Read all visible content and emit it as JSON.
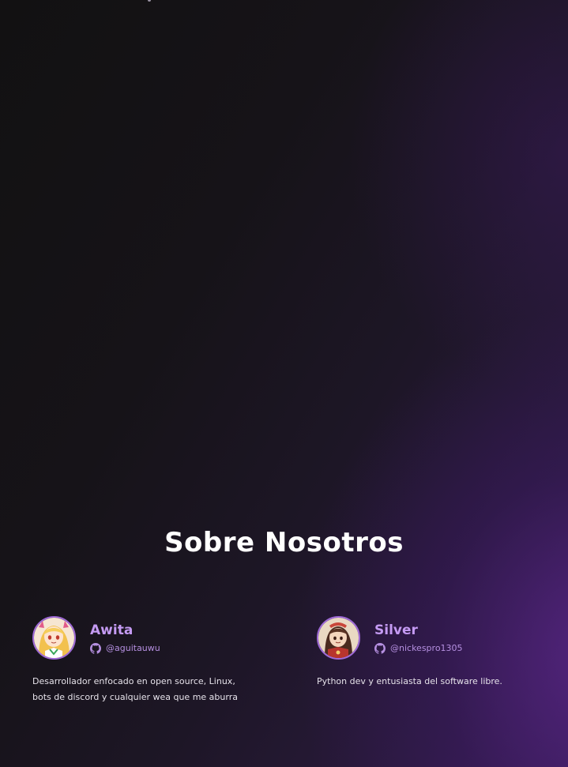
{
  "section": {
    "title": "Sobre Nosotros"
  },
  "members": [
    {
      "name": "Awita",
      "github": "@aguitauwu",
      "description": "Desarrollador enfocado en open source, Linux, bots de discord y cualquier wea que me aburra",
      "avatar_icon": "avatar-anime-girl-blonde",
      "github_icon": "github-icon"
    },
    {
      "name": "Silver",
      "github": "@nickespro1305",
      "description": "Python dev y entusiasta del software libre.",
      "avatar_icon": "avatar-anime-girl-brown",
      "github_icon": "github-icon"
    }
  ],
  "colors": {
    "accent": "#c49af2",
    "avatar_border": "#a06ad8",
    "background_dark": "#121112",
    "background_purple": "#3a1f57"
  }
}
